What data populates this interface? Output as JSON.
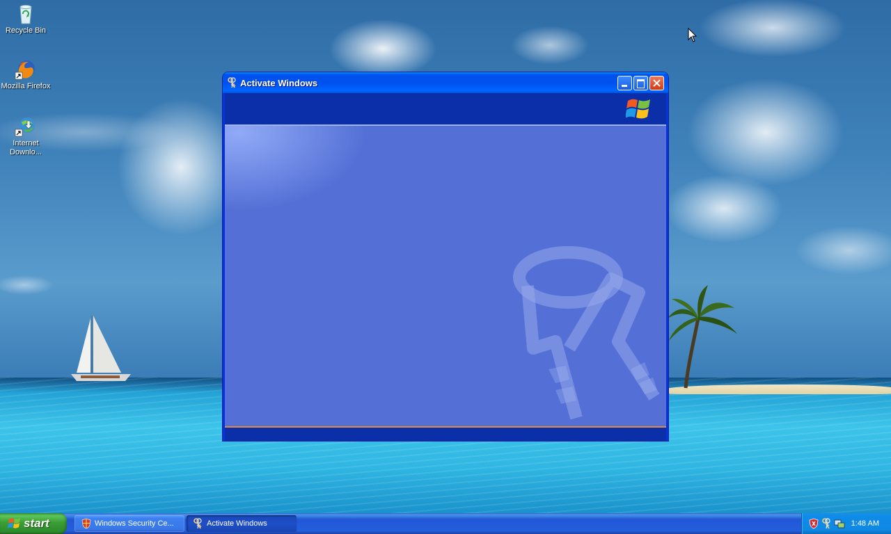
{
  "desktop": {
    "icons": [
      {
        "label": "Recycle Bin",
        "icon": "recycle-bin-icon"
      },
      {
        "label": "Mozilla Firefox",
        "icon": "firefox-icon"
      },
      {
        "label": "Internet Downlo...",
        "icon": "internet-download-manager-icon"
      }
    ]
  },
  "window": {
    "title": "Activate Windows",
    "icon": "keys-icon",
    "controls": [
      "minimize",
      "maximize",
      "close"
    ],
    "header_logo": "windows-flag-icon",
    "body_watermark": "keys-watermark-icon"
  },
  "taskbar": {
    "start_label": "start",
    "tasks": [
      {
        "label": "Windows Security Ce...",
        "icon": "security-shield-icon",
        "active": false
      },
      {
        "label": "Activate Windows",
        "icon": "keys-icon",
        "active": true
      }
    ],
    "tray": {
      "icons": [
        "security-alert-shield-icon",
        "activation-keys-icon",
        "network-icon"
      ],
      "clock": "1:48 AM"
    }
  },
  "colors": {
    "taskbar_blue": "#245edb",
    "start_green": "#3a9e34",
    "title_blue": "#0053ee",
    "wizard_body": "#5470d6",
    "wizard_band": "#0a2fa8"
  }
}
